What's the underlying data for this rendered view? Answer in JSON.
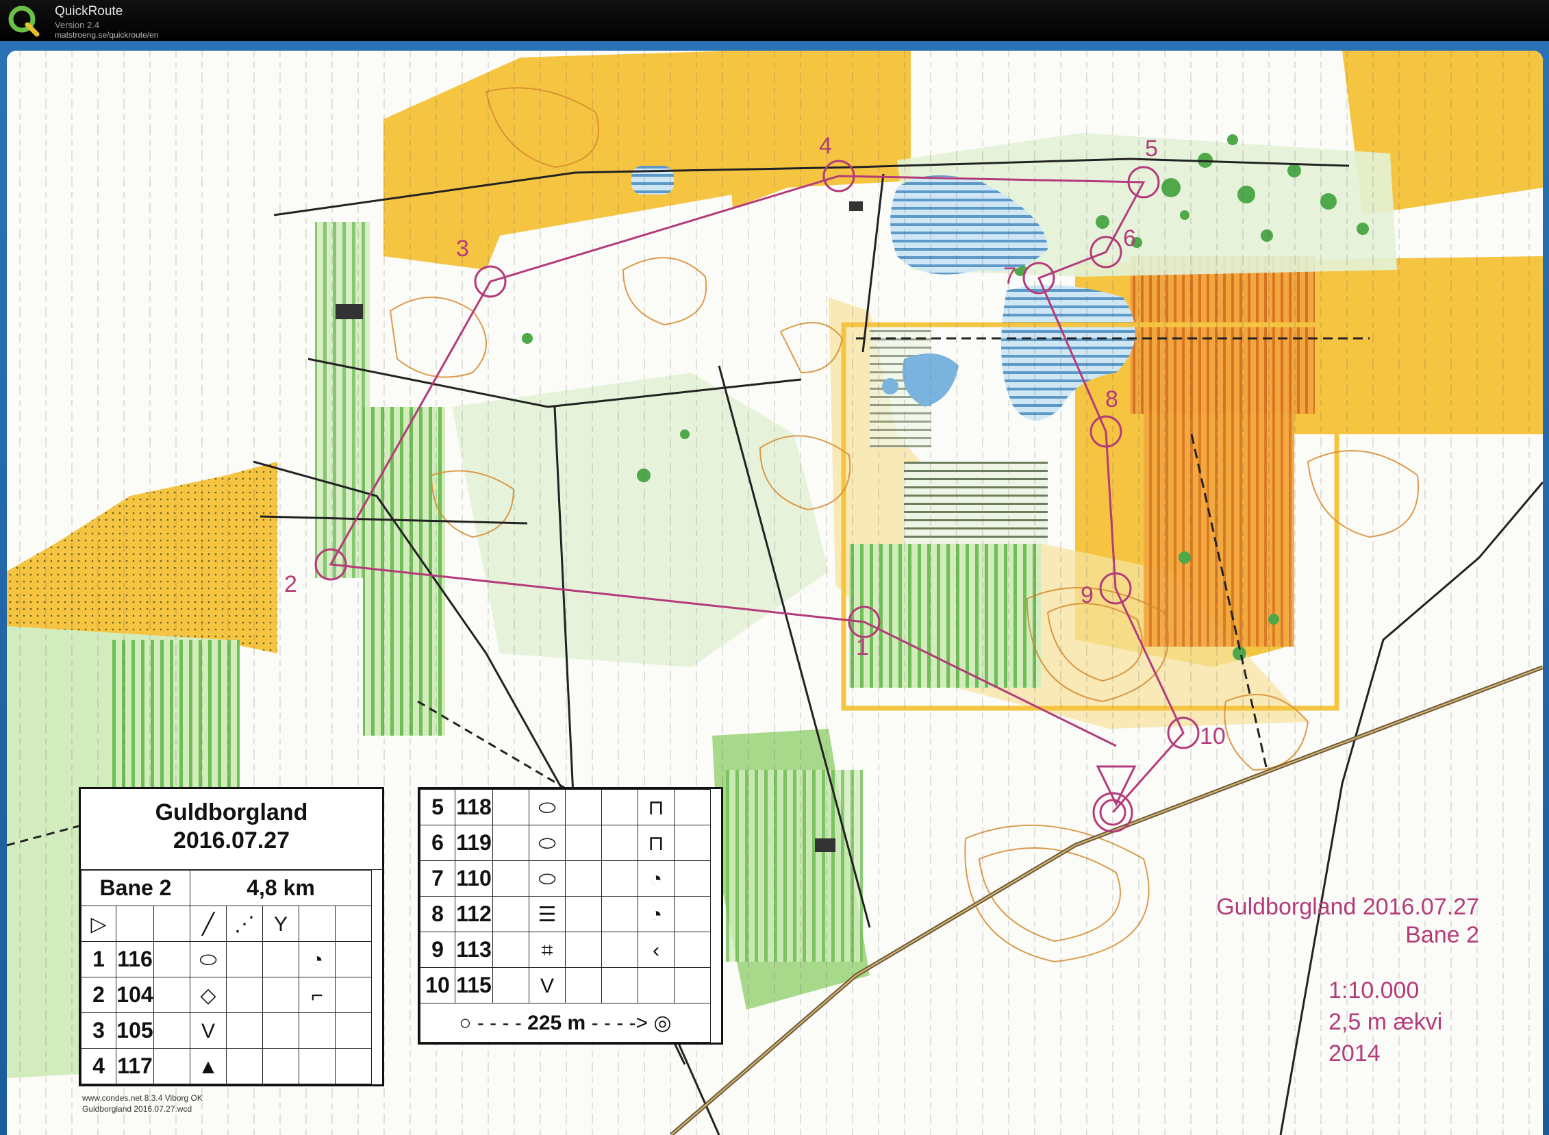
{
  "app": {
    "name": "QuickRoute",
    "version": "Version 2.4",
    "url": "matstroeng.se/quickroute/en"
  },
  "map": {
    "course_title": "Guldborgland 2016.07.27",
    "course_name": "Bane 2",
    "scale": "1:10.000",
    "equidistance": "2,5 m ækvi",
    "year": "2014",
    "colors": {
      "course": "#b43b7a",
      "open_land": "#f5c542",
      "rough_open": "#fbe08a",
      "forest_green": "#a8d88a",
      "dark_green": "#4fa84a",
      "water": "#7ab3de",
      "contour": "#d7892e",
      "plowed_orange": "#e88a2a"
    },
    "controls": [
      {
        "label": "1"
      },
      {
        "label": "2"
      },
      {
        "label": "3"
      },
      {
        "label": "4"
      },
      {
        "label": "5"
      },
      {
        "label": "6"
      },
      {
        "label": "7"
      },
      {
        "label": "8"
      },
      {
        "label": "9"
      },
      {
        "label": "10"
      }
    ]
  },
  "description": {
    "event": "Guldborgland",
    "date": "2016.07.27",
    "course": "Bane 2",
    "length": "4,8 km",
    "left_rows": [
      {
        "num": "1",
        "code": "116",
        "feature": "knoll",
        "detail": "part"
      },
      {
        "num": "2",
        "code": "104",
        "feature": "depression",
        "detail": "corner"
      },
      {
        "num": "3",
        "code": "105",
        "feature": "gully",
        "detail": ""
      },
      {
        "num": "4",
        "code": "117",
        "feature": "boulders",
        "detail": ""
      }
    ],
    "right_rows": [
      {
        "num": "5",
        "code": "118",
        "feature": "knoll",
        "detail": "foot"
      },
      {
        "num": "6",
        "code": "119",
        "feature": "knoll",
        "detail": "foot"
      },
      {
        "num": "7",
        "code": "110",
        "feature": "knoll",
        "detail": "part"
      },
      {
        "num": "8",
        "code": "112",
        "feature": "marsh",
        "detail": "part"
      },
      {
        "num": "9",
        "code": "113",
        "feature": "thicket",
        "detail": "corner"
      },
      {
        "num": "10",
        "code": "115",
        "feature": "gully",
        "detail": ""
      }
    ],
    "finish_distance": "225 m",
    "credit_line1": "www.condes.net 8.3.4 Viborg OK",
    "credit_line2": "Guldborgland 2016.07.27.wcd"
  }
}
